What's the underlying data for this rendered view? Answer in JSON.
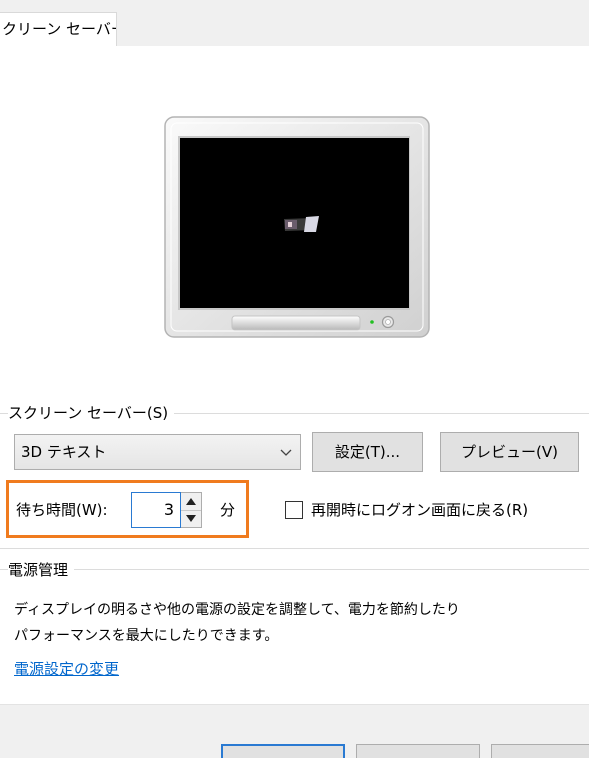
{
  "tab": {
    "label": "クリーン セーバー"
  },
  "screensaver_group": {
    "label": "スクリーン セーバー(S)",
    "selected": "3D テキスト",
    "settings_button": "設定(T)...",
    "preview_button": "プレビュー(V)"
  },
  "wait": {
    "label": "待ち時間(W):",
    "value": "3",
    "unit": "分"
  },
  "resume_checkbox": {
    "label": "再開時にログオン画面に戻る(R)",
    "checked": false
  },
  "power_group": {
    "label": "電源管理",
    "description_line1": "ディスプレイの明るさや他の電源の設定を調整して、電力を節約したり",
    "description_line2": "パフォーマンスを最大にしたりできます。",
    "link": "電源設定の変更"
  },
  "colors": {
    "highlight": "#f07b1e",
    "link": "#0066cc",
    "focus": "#2a7ad2"
  }
}
